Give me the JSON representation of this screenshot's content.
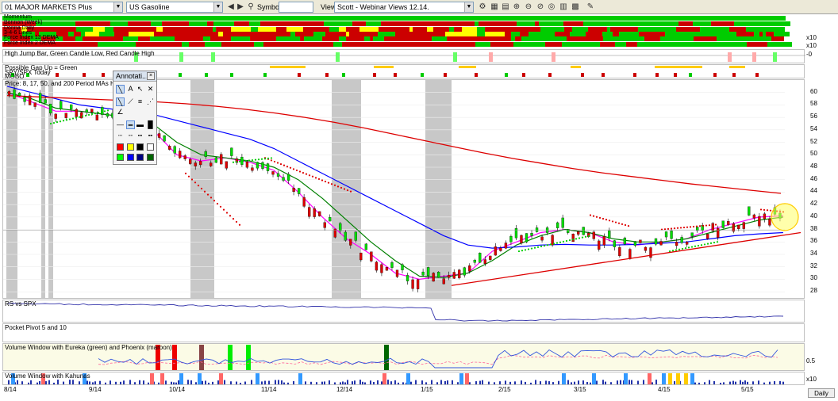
{
  "toolbar": {
    "watchlist": "01 MAJOR MARKETS Plus",
    "symbol_name": "US Gasoline",
    "symbol_label": "Symbol:",
    "symbol_value": "",
    "view_label": "View:",
    "view_value": "Scott - Webinar Views 12.14."
  },
  "stripes": [
    "Momentum",
    "Bonnon (Week)",
    "Donna Daily",
    "3-4-6 Lines",
    "Force Index 13 DEMA",
    "Force Index 2 DEMA"
  ],
  "stripe_right_labels": [
    "x10",
    "x10"
  ],
  "high_jump_label": "High Jump Bar, Green Candle Low, Red Candle High",
  "high_jump_axis": "-0",
  "breakout_labels": [
    "Possible Gap Up = Green",
    "SPY/SPX Today",
    "MOBO"
  ],
  "price_panel_label": "Price: 8, 17, 50, and 200 Period MAs HINDY",
  "rs_label": "RS vs SPX",
  "pocket_label": "Pocket Pivot 5 and 10",
  "volume_eureka_label": "Volume Window with Eureka (green) and Phoenix (maroon)",
  "volume_eureka_axis": "0.5",
  "volume_kahunas_label": "Volume Window with Kahunas",
  "volume_kahunas_axis": "x10",
  "annotation": {
    "title": "Annotati..."
  },
  "date_labels": [
    "8/14",
    "9/14",
    "10/14",
    "11/14",
    "12/14",
    "1/15",
    "2/15",
    "3/15",
    "4/15",
    "5/15"
  ],
  "daily_button": "Daily",
  "chart_data": {
    "type": "line",
    "y_ticks": [
      28,
      30,
      32,
      34,
      36,
      38,
      40,
      42,
      44,
      46,
      48,
      50,
      52,
      54,
      56,
      58,
      60
    ],
    "ylim": [
      27,
      62
    ],
    "x_labels": [
      "8/14",
      "9/14",
      "10/14",
      "11/14",
      "12/14",
      "1/15",
      "2/15",
      "3/15",
      "4/15",
      "5/15"
    ],
    "series": [
      {
        "name": "8",
        "color": "#ff00ff",
        "values": [
          60,
          58.5,
          57,
          57,
          56.5,
          56,
          54,
          50,
          49,
          49.5,
          48.8,
          47.5,
          44,
          40,
          36.5,
          34,
          31,
          30,
          30.5,
          31,
          34.5,
          36,
          37.5,
          38,
          37.5,
          36,
          35.5,
          36,
          36.5,
          38,
          39,
          40,
          40.2
        ]
      },
      {
        "name": "17",
        "color": "#008000",
        "values": [
          60,
          59,
          57.5,
          57,
          56.5,
          56,
          55,
          52,
          50,
          49.5,
          49,
          48,
          46,
          43,
          39.5,
          36,
          33,
          30.5,
          30.3,
          31,
          33,
          35.5,
          37,
          38,
          37.5,
          36.5,
          36,
          36,
          36.5,
          37.5,
          38.5,
          39.5,
          40
        ]
      },
      {
        "name": "50",
        "color": "#0000ff",
        "values": [
          61,
          60,
          59,
          58,
          57.5,
          57,
          56.5,
          55.5,
          54.5,
          53.5,
          52.5,
          51,
          49,
          47,
          45,
          43,
          41,
          39,
          37,
          35.5,
          35,
          35.2,
          35.5,
          35.6,
          35.5,
          35.5,
          35.6,
          35.8,
          36,
          36.5,
          37,
          37.3,
          37.5
        ]
      },
      {
        "name": "200",
        "color": "#dd0000",
        "values": [
          59.5,
          59.3,
          59.1,
          58.9,
          58.7,
          58.5,
          58.2,
          57.8,
          57.3,
          56.7,
          56,
          55.2,
          54.3,
          53.3,
          52.3,
          51.3,
          50.3,
          49.4,
          48.6,
          47.8,
          47.1,
          46.5,
          45.9,
          45.3,
          44.8,
          44.3,
          43.8
        ]
      }
    ],
    "trendline": {
      "from": [
        "1/15",
        29
      ],
      "to": [
        "5/15",
        37.5
      ]
    }
  }
}
